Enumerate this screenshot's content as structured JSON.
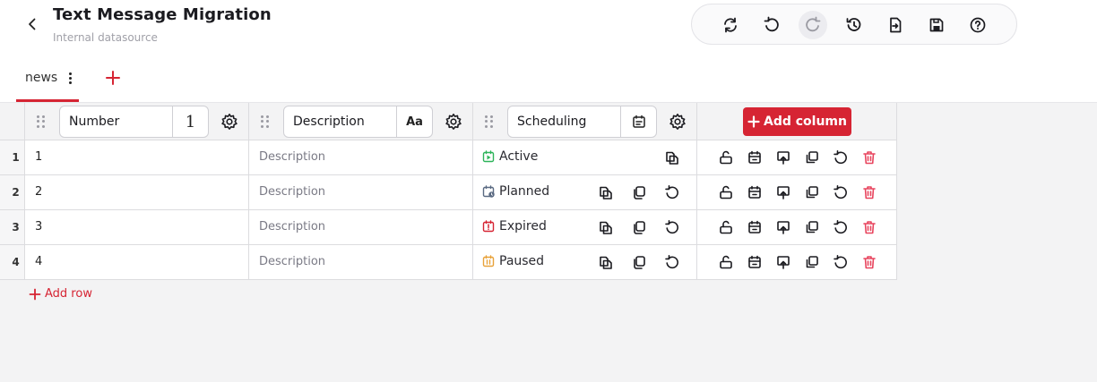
{
  "header": {
    "title": "Text Message Migration",
    "subtitle": "Internal datasource"
  },
  "toolbar": [
    {
      "icon": "refresh-icon",
      "name": "refresh-button"
    },
    {
      "icon": "undo-icon",
      "name": "undo-button"
    },
    {
      "icon": "redo-icon",
      "name": "redo-button",
      "disabled": true
    },
    {
      "icon": "history-icon",
      "name": "history-button"
    },
    {
      "icon": "export-icon",
      "name": "export-button"
    },
    {
      "icon": "save-icon",
      "name": "save-button"
    },
    {
      "icon": "help-icon",
      "name": "help-button"
    }
  ],
  "tabs": [
    {
      "label": "news",
      "active": true
    }
  ],
  "columns": [
    {
      "name": "Number",
      "type_glyph": "1",
      "type": "number"
    },
    {
      "name": "Description",
      "type_glyph": "Aa",
      "type": "text"
    },
    {
      "name": "Scheduling",
      "type_glyph": "calendar-icon",
      "type": "scheduling"
    }
  ],
  "add_column_label": "Add column",
  "rows": [
    {
      "index": "1",
      "number": "1",
      "description": "Description",
      "status": "Active",
      "status_icon": "play-calendar-icon",
      "status_color": "#2db45a"
    },
    {
      "index": "2",
      "number": "2",
      "description": "Description",
      "status": "Planned",
      "status_icon": "clock-calendar-icon",
      "status_color": "#5a6a82"
    },
    {
      "index": "3",
      "number": "3",
      "description": "Description",
      "status": "Expired",
      "status_icon": "alert-calendar-icon",
      "status_color": "#d62433"
    },
    {
      "index": "4",
      "number": "4",
      "description": "Description",
      "status": "Paused",
      "status_icon": "pause-calendar-icon",
      "status_color": "#e8a23a"
    }
  ],
  "add_row_label": "Add row",
  "colors": {
    "accent": "#d62433",
    "border": "#dcdcdf",
    "background": "#f3f3f4"
  }
}
